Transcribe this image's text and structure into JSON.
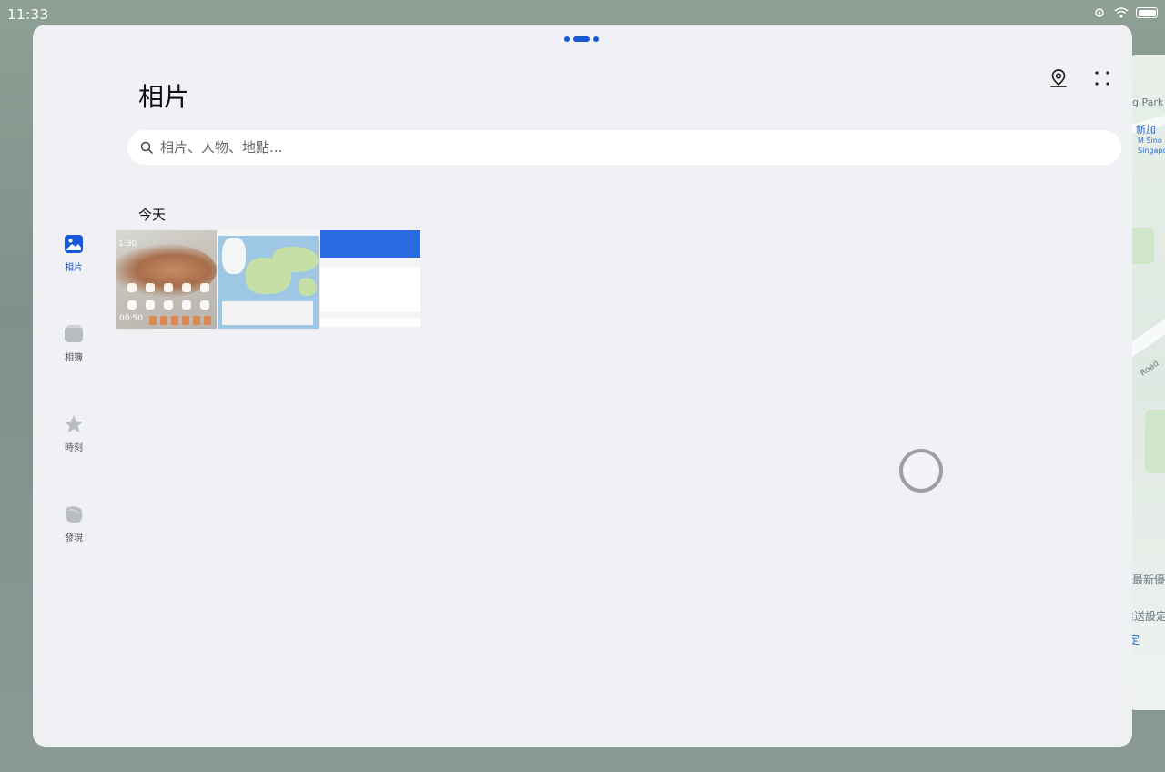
{
  "status_bar": {
    "time": "11:33"
  },
  "window": {
    "title": "相片"
  },
  "search": {
    "placeholder": "相片、人物、地點..."
  },
  "section": {
    "title": "今天"
  },
  "nav": {
    "items": [
      {
        "label": "相片",
        "icon": "photos-icon",
        "active": true
      },
      {
        "label": "相簿",
        "icon": "albums-icon",
        "active": false
      },
      {
        "label": "時刻",
        "icon": "moments-icon",
        "active": false
      },
      {
        "label": "發現",
        "icon": "discover-icon",
        "active": false
      }
    ]
  },
  "thumbnails": {
    "t1": {
      "clock_top": "1:30",
      "clock_bottom": "00:50"
    }
  },
  "background_map": {
    "labels": [
      "g Park",
      "新加",
      "M Sino",
      "Singapo",
      "Road",
      "加最新優",
      "推送設定",
      "定"
    ]
  },
  "colors": {
    "accent": "#1a57d6",
    "window_bg": "#eff1f5"
  }
}
